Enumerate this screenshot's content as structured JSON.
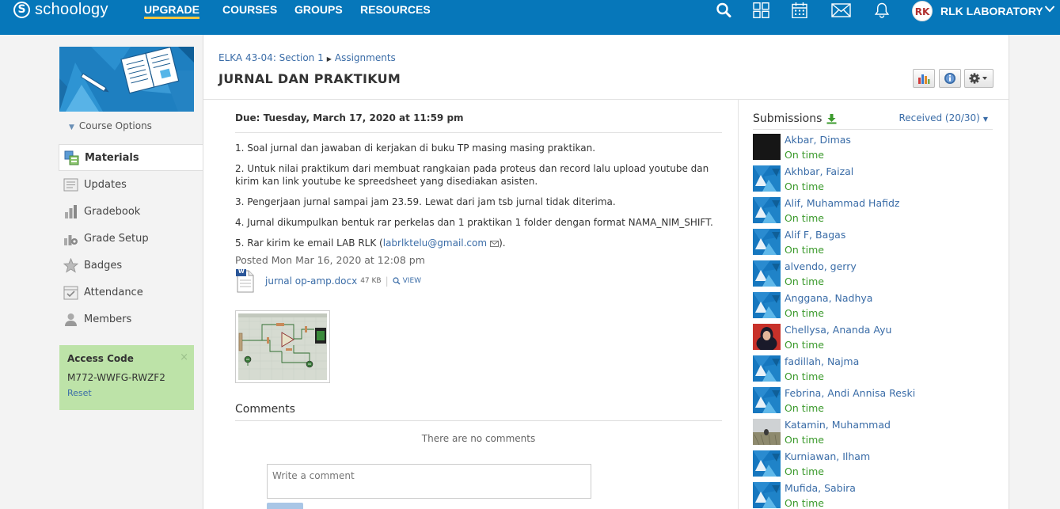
{
  "topbar": {
    "logo_letter": "S",
    "logo_text": "schoology",
    "nav": [
      "UPGRADE",
      "COURSES",
      "GROUPS",
      "RESOURCES"
    ],
    "profile_name": "RLK LABORATORY",
    "profile_avatar_text": "RK",
    "color": "#0677ba",
    "accent": "#f3c53f"
  },
  "sidebar": {
    "course_options": "Course Options",
    "items": [
      {
        "label": "Materials",
        "icon": "materials-icon",
        "active": true
      },
      {
        "label": "Updates",
        "icon": "updates-icon"
      },
      {
        "label": "Gradebook",
        "icon": "gradebook-icon"
      },
      {
        "label": "Grade Setup",
        "icon": "grade-setup-icon"
      },
      {
        "label": "Badges",
        "icon": "badges-icon"
      },
      {
        "label": "Attendance",
        "icon": "attendance-icon"
      },
      {
        "label": "Members",
        "icon": "members-icon"
      }
    ],
    "access_code": {
      "title": "Access Code",
      "code": "M772-WWFG-RWZF2",
      "reset": "Reset",
      "close": "×"
    }
  },
  "header": {
    "breadcrumb": [
      "ELKA 43-04: Section 1",
      "Assignments"
    ],
    "breadcrumb_sep": "▶",
    "title": "JURNAL DAN PRAKTIKUM"
  },
  "assignment": {
    "due": "Due: Tuesday, March 17, 2020 at 11:59 pm",
    "paragraphs": [
      "1. Soal jurnal dan jawaban di kerjakan di buku TP masing masing praktikan.",
      "2. Untuk nilai praktikum dari membuat rangkaian pada proteus dan record lalu upload youtube dan kirim kan link youtube ke spreedsheet yang disediakan asisten.",
      "3. Pengerjaan jurnal sampai jam 23.59. Lewat dari jam tsb jurnal tidak diterima.",
      "4. Jurnal dikumpulkan bentuk rar perkelas dan 1 praktikan 1 folder dengan format NAMA_NIM_SHIFT."
    ],
    "p5_prefix": "5. Rar kirim ke email LAB RLK (",
    "p5_email": "labrlktelu@gmail.com",
    "p5_suffix": ").",
    "posted": "Posted Mon Mar 16, 2020 at 12:08 pm",
    "attachment": {
      "name": "jurnal op-amp.docx",
      "size": "47 KB",
      "sep": "|",
      "view": "VIEW",
      "badge": "W"
    }
  },
  "comments": {
    "title": "Comments",
    "empty": "There are no comments",
    "placeholder": "Write a comment"
  },
  "submissions": {
    "title": "Submissions",
    "received": "Received (20/30)",
    "items": [
      {
        "name": "Akbar, Dimas",
        "status": "On time",
        "thumb": "dark"
      },
      {
        "name": "Akhbar, Faizal",
        "status": "On time",
        "thumb": "default"
      },
      {
        "name": "Alif, Muhammad Hafidz",
        "status": "On time",
        "thumb": "default"
      },
      {
        "name": "Alif F, Bagas",
        "status": "On time",
        "thumb": "default"
      },
      {
        "name": "alvendo, gerry",
        "status": "On time",
        "thumb": "default"
      },
      {
        "name": "Anggana, Nadhya",
        "status": "On time",
        "thumb": "default"
      },
      {
        "name": "Chellysa, Ananda Ayu",
        "status": "On time",
        "thumb": "photo-red"
      },
      {
        "name": "fadillah, Najma",
        "status": "On time",
        "thumb": "default"
      },
      {
        "name": "Febrina, Andi Annisa Reski",
        "status": "On time",
        "thumb": "default"
      },
      {
        "name": "Katamin, Muhammad",
        "status": "On time",
        "thumb": "photo-field"
      },
      {
        "name": "Kurniawan, Ilham",
        "status": "On time",
        "thumb": "default"
      },
      {
        "name": "Mufida, Sabira",
        "status": "On time",
        "thumb": "default"
      }
    ]
  }
}
